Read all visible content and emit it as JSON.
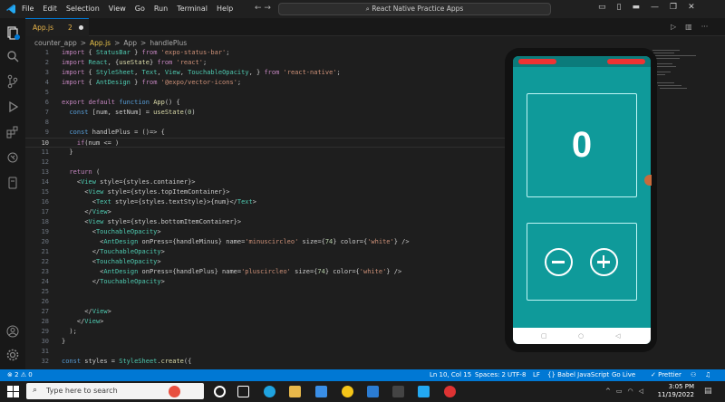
{
  "titlebar": {
    "menu": [
      "File",
      "Edit",
      "Selection",
      "View",
      "Go",
      "Run",
      "Terminal",
      "Help"
    ],
    "search_text": "React Native Practice Apps"
  },
  "tab": {
    "name": "App.js",
    "badge": "2"
  },
  "breadcrumb": [
    "counter_app",
    ">",
    "App.js",
    ">",
    "App",
    ">",
    "handlePlus"
  ],
  "code_lines": [
    {
      "n": "1",
      "t": "import { StatusBar } from 'expo-status-bar';"
    },
    {
      "n": "2",
      "t": "import React, {useState} from 'react';"
    },
    {
      "n": "3",
      "t": "import { StyleSheet, Text, View, TouchableOpacity, } from 'react-native';"
    },
    {
      "n": "4",
      "t": "import { AntDesign } from '@expo/vector-icons';"
    },
    {
      "n": "5",
      "t": ""
    },
    {
      "n": "6",
      "t": "export default function App() {"
    },
    {
      "n": "7",
      "t": "  const [num, setNum] = useState(0)"
    },
    {
      "n": "8",
      "t": ""
    },
    {
      "n": "9",
      "t": "  const handlePlus = ()=> {"
    },
    {
      "n": "10",
      "t": "    if(num <= )"
    },
    {
      "n": "11",
      "t": "  }"
    },
    {
      "n": "12",
      "t": ""
    },
    {
      "n": "13",
      "t": "  return ("
    },
    {
      "n": "14",
      "t": "    <View style={styles.container}>"
    },
    {
      "n": "15",
      "t": "      <View style={styles.topItemContainer}>"
    },
    {
      "n": "16",
      "t": "        <Text style={styles.textStyle}>{num}</Text>"
    },
    {
      "n": "17",
      "t": "      </View>"
    },
    {
      "n": "18",
      "t": "      <View style={styles.bottomItemContainer}>"
    },
    {
      "n": "19",
      "t": "        <TouchableOpacity>"
    },
    {
      "n": "20",
      "t": "          <AntDesign onPress={handleMinus} name='minuscircleo' size={74} color={'white'} />"
    },
    {
      "n": "21",
      "t": "        </TouchableOpacity>"
    },
    {
      "n": "22",
      "t": "        <TouchableOpacity>"
    },
    {
      "n": "23",
      "t": "          <AntDesign onPress={handlePlus} name='pluscircleo' size={74} color={'white'} />"
    },
    {
      "n": "24",
      "t": "        </TouchableOpacity>"
    },
    {
      "n": "25",
      "t": ""
    },
    {
      "n": "26",
      "t": ""
    },
    {
      "n": "27",
      "t": "      </View>"
    },
    {
      "n": "28",
      "t": "    </View>"
    },
    {
      "n": "29",
      "t": "  );"
    },
    {
      "n": "30",
      "t": "}"
    },
    {
      "n": "31",
      "t": ""
    },
    {
      "n": "32",
      "t": "const styles = StyleSheet.create({"
    }
  ],
  "phone": {
    "counter_value": "0",
    "screen_color": "#0f9a9a"
  },
  "statusbar": {
    "problems": "⊗ 2 ⚠ 0",
    "position": "Ln 10, Col 15",
    "spaces": "Spaces: 2",
    "encoding": "UTF-8",
    "eol": "LF",
    "language": "{} Babel JavaScript",
    "golive": "Go Live",
    "prettier": "✓ Prettier"
  },
  "taskbar": {
    "search_placeholder": "Type here to search",
    "time": "3:05 PM",
    "date": "11/19/2022"
  }
}
